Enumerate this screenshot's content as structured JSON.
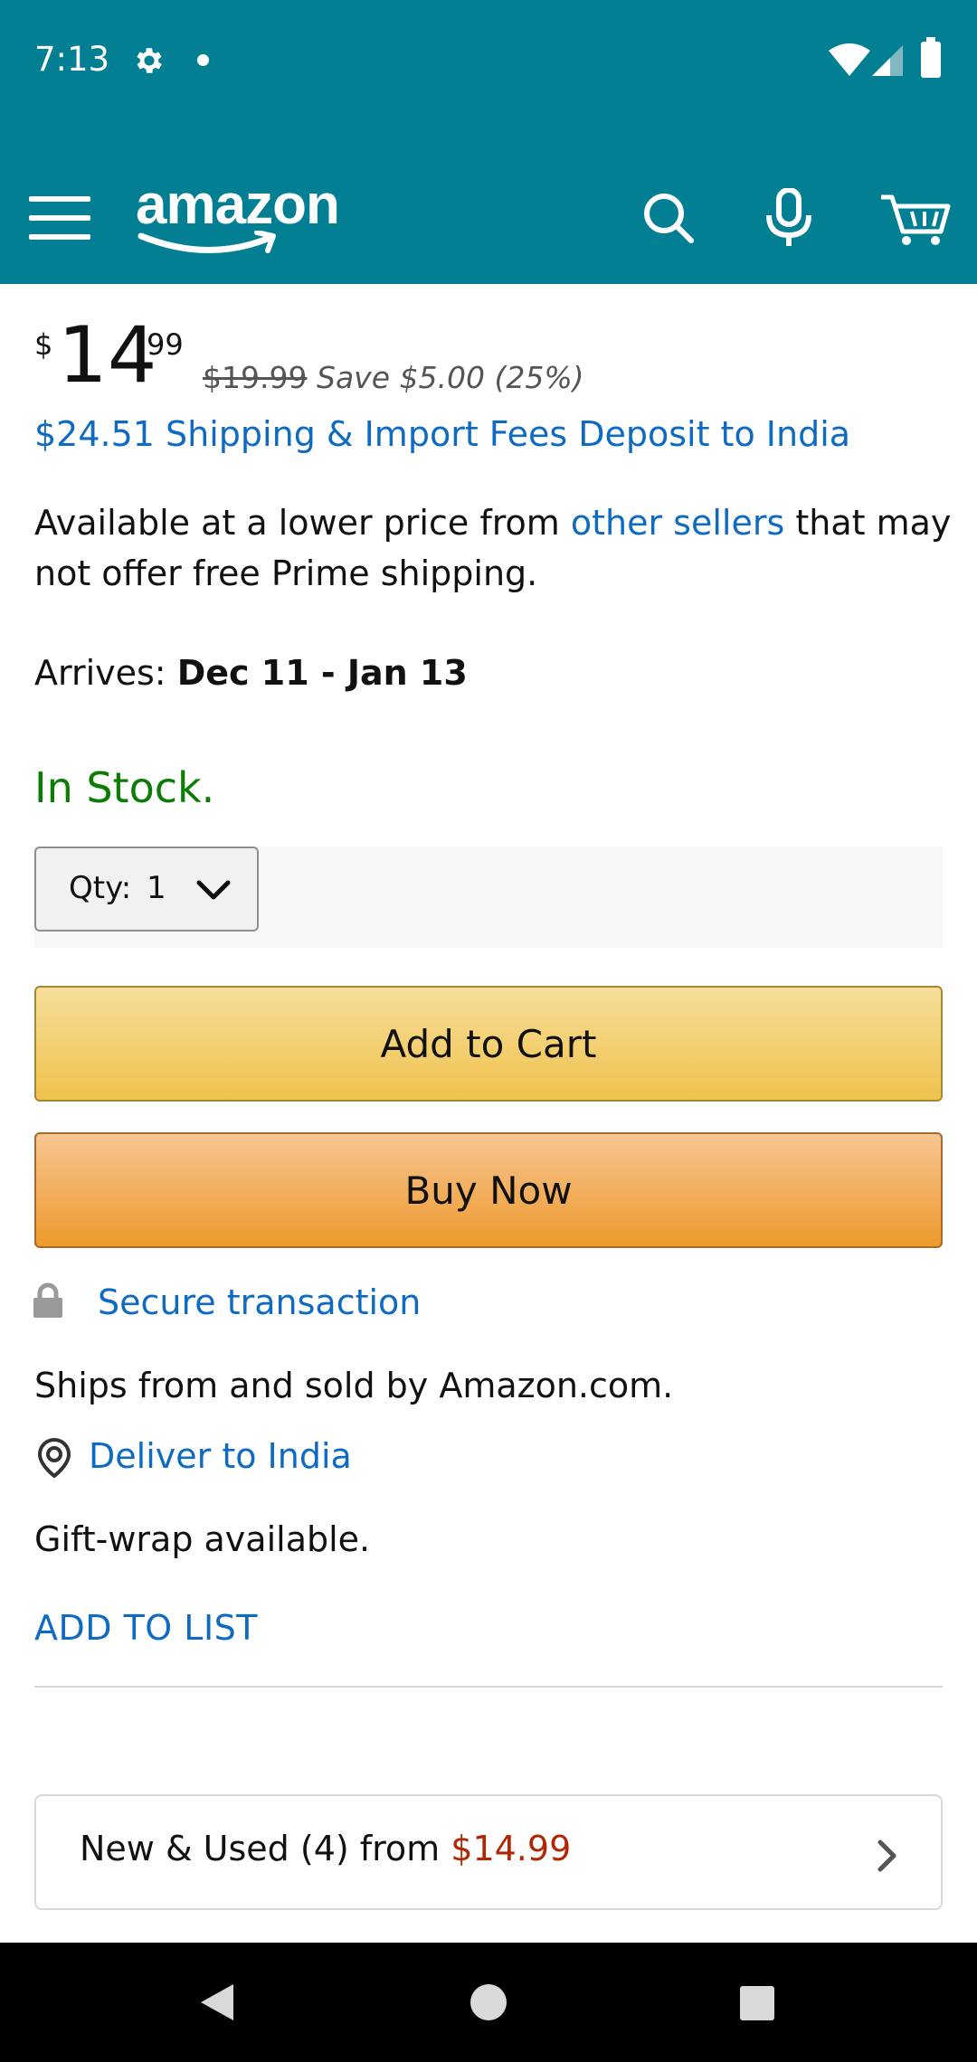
{
  "status_bar": {
    "time": "7:13",
    "icons": [
      "gear-icon",
      "notification-dot",
      "wifi-icon",
      "cell-signal-icon",
      "battery-icon"
    ]
  },
  "header": {
    "logo_text": "amazon",
    "icons": [
      "menu-icon",
      "search-icon",
      "microphone-icon",
      "cart-icon"
    ],
    "background": "#027f93"
  },
  "price": {
    "currency": "$",
    "whole": "14",
    "fraction": "99",
    "list_price": "$19.99",
    "savings": "Save $5.00 (25%)",
    "shipping": "$24.51 Shipping & Import Fees Deposit to India"
  },
  "availability": {
    "line1_prefix": "Available at a lower price from ",
    "line1_link": "other sellers",
    "line1_suffix": " that may",
    "line2": "not offer free Prime shipping."
  },
  "arrival": {
    "label": "Arrives: ",
    "dates": "Dec 11 - Jan 13"
  },
  "stock": {
    "status": "In Stock.",
    "color": "#0b7c04"
  },
  "quantity": {
    "label": "Qty:",
    "value": "1"
  },
  "buttons": {
    "add_to_cart": "Add to Cart",
    "buy_now": "Buy Now"
  },
  "details": {
    "secure": "Secure transaction",
    "ships": "Ships from and sold by Amazon.com.",
    "deliver": "Deliver to India",
    "gift": "Gift-wrap available.",
    "add_to_list": "ADD TO LIST"
  },
  "offers": {
    "text": "New & Used (4) from ",
    "price": "$14.99",
    "price_color": "#b12704"
  },
  "colors": {
    "link": "#0f6bc2",
    "cart_button": "#f0c24d",
    "buy_button": "#ee9a2c"
  }
}
